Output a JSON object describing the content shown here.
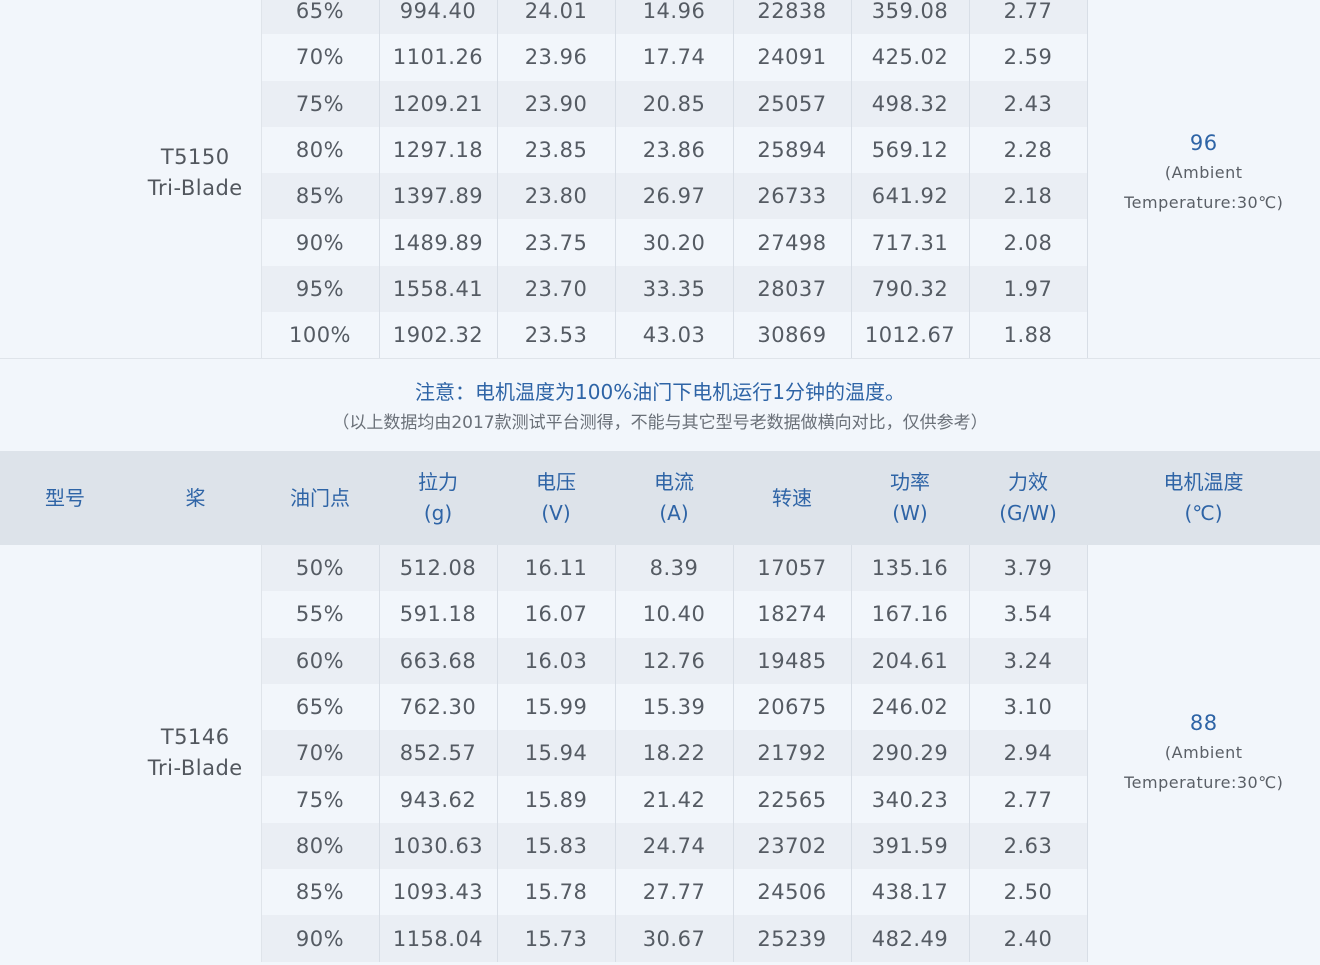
{
  "table1": {
    "model": [
      "T5150",
      "Tri-Blade"
    ],
    "temp_value": "96",
    "temp_note": [
      "(Ambient",
      "Temperature:30℃)"
    ],
    "rows": [
      [
        "65%",
        "994.40",
        "24.01",
        "14.96",
        "22838",
        "359.08",
        "2.77"
      ],
      [
        "70%",
        "1101.26",
        "23.96",
        "17.74",
        "24091",
        "425.02",
        "2.59"
      ],
      [
        "75%",
        "1209.21",
        "23.90",
        "20.85",
        "25057",
        "498.32",
        "2.43"
      ],
      [
        "80%",
        "1297.18",
        "23.85",
        "23.86",
        "25894",
        "569.12",
        "2.28"
      ],
      [
        "85%",
        "1397.89",
        "23.80",
        "26.97",
        "26733",
        "641.92",
        "2.18"
      ],
      [
        "90%",
        "1489.89",
        "23.75",
        "30.20",
        "27498",
        "717.31",
        "2.08"
      ],
      [
        "95%",
        "1558.41",
        "23.70",
        "33.35",
        "28037",
        "790.32",
        "1.97"
      ],
      [
        "100%",
        "1902.32",
        "23.53",
        "43.03",
        "30869",
        "1012.67",
        "1.88"
      ]
    ]
  },
  "note": {
    "main": "注意：电机温度为100%油门下电机运行1分钟的温度。",
    "sub": "（以上数据均由2017款测试平台测得，不能与其它型号老数据做横向对比，仅供参考）"
  },
  "header": {
    "model": "型号",
    "prop": "桨",
    "throttle": "油门点",
    "thrust": [
      "拉力",
      "(g)"
    ],
    "voltage": [
      "电压",
      "(V)"
    ],
    "current": [
      "电流",
      "(A)"
    ],
    "speed": "转速",
    "power": [
      "功率",
      "(W)"
    ],
    "efficiency": [
      "力效",
      "(G/W)"
    ],
    "temperature": [
      "电机温度",
      "(℃)"
    ]
  },
  "table2": {
    "model": [
      "T5146",
      "Tri-Blade"
    ],
    "temp_value": "88",
    "temp_note": [
      "(Ambient",
      "Temperature:30℃)"
    ],
    "rows": [
      [
        "50%",
        "512.08",
        "16.11",
        "8.39",
        "17057",
        "135.16",
        "3.79"
      ],
      [
        "55%",
        "591.18",
        "16.07",
        "10.40",
        "18274",
        "167.16",
        "3.54"
      ],
      [
        "60%",
        "663.68",
        "16.03",
        "12.76",
        "19485",
        "204.61",
        "3.24"
      ],
      [
        "65%",
        "762.30",
        "15.99",
        "15.39",
        "20675",
        "246.02",
        "3.10"
      ],
      [
        "70%",
        "852.57",
        "15.94",
        "18.22",
        "21792",
        "290.29",
        "2.94"
      ],
      [
        "75%",
        "943.62",
        "15.89",
        "21.42",
        "22565",
        "340.23",
        "2.77"
      ],
      [
        "80%",
        "1030.63",
        "15.83",
        "24.74",
        "23702",
        "391.59",
        "2.63"
      ],
      [
        "85%",
        "1093.43",
        "15.78",
        "27.77",
        "24506",
        "438.17",
        "2.50"
      ],
      [
        "90%",
        "1158.04",
        "15.73",
        "30.67",
        "25239",
        "482.49",
        "2.40"
      ]
    ]
  }
}
